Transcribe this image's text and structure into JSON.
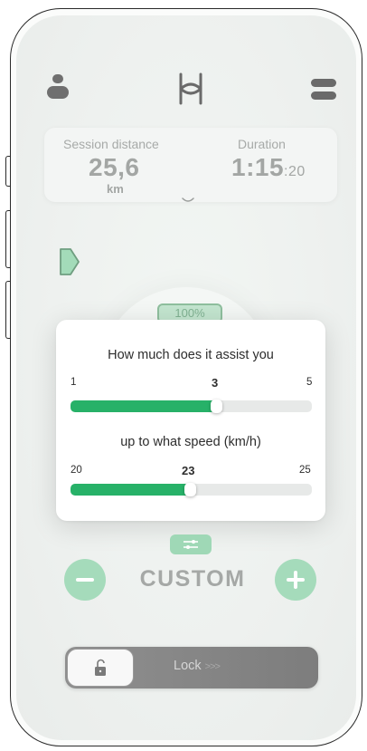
{
  "header": {
    "user_icon": "user-icon",
    "logo_icon": "brand-logo",
    "menu_icon": "menu-icon"
  },
  "stats": {
    "session_distance_label": "Session distance",
    "session_distance_value": "25,6",
    "session_distance_unit": "km",
    "duration_label": "Duration",
    "duration_value": "1:15",
    "duration_seconds": ":20",
    "expand_icon": "chevron-down-icon"
  },
  "battery": {
    "percent_label": "100%",
    "level_fraction": 1.0
  },
  "assist_modal": {
    "assist_question": "How much does it assist you",
    "assist_min": "1",
    "assist_value": "3",
    "assist_max": "5",
    "speed_question": "up to what speed (km/h)",
    "speed_min": "20",
    "speed_value": "23",
    "speed_max": "25"
  },
  "mode": {
    "label": "CUSTOM",
    "decrease_icon": "minus-icon",
    "increase_icon": "plus-icon",
    "settings_icon": "sliders-icon"
  },
  "lock": {
    "label": "Lock",
    "arrows": ">>>",
    "icon": "unlock-icon"
  },
  "colors": {
    "accent": "#27b168",
    "accent_light": "#a5dbbb",
    "background": "#eef1ef",
    "muted_text": "#a5a8a6"
  }
}
